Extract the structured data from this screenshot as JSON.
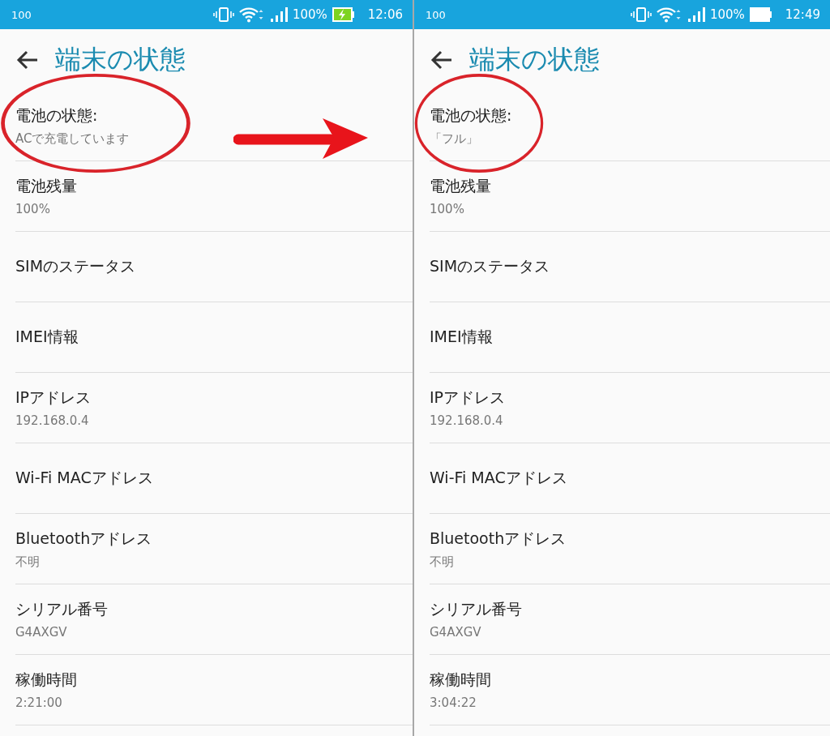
{
  "panels": [
    {
      "status_bar": {
        "left_text": "100",
        "battery_text": "100%",
        "charging": true,
        "time": "12:06"
      },
      "title": "端末の状態",
      "items": [
        {
          "title": "電池の状態:",
          "summary": "ACで充電しています",
          "circled": true
        },
        {
          "title": "電池残量",
          "summary": "100%",
          "circled": false
        },
        {
          "title": "SIMのステータス",
          "circled": false
        },
        {
          "title": "IMEI情報",
          "circled": false
        },
        {
          "title": "IPアドレス",
          "summary": "192.168.0.4",
          "circled": false
        },
        {
          "title": "Wi-Fi MACアドレス",
          "circled": false
        },
        {
          "title": "Bluetoothアドレス",
          "summary": "不明",
          "circled": false
        },
        {
          "title": "シリアル番号",
          "summary": "G4AXGV",
          "circled": false
        },
        {
          "title": "稼働時間",
          "summary": "2:21:00",
          "circled": false
        }
      ]
    },
    {
      "status_bar": {
        "left_text": "100",
        "battery_text": "100%",
        "charging": false,
        "time": "12:49"
      },
      "title": "端末の状態",
      "items": [
        {
          "title": "電池の状態:",
          "summary": "「フル」",
          "circled": true
        },
        {
          "title": "電池残量",
          "summary": "100%",
          "circled": false
        },
        {
          "title": "SIMのステータス",
          "circled": false
        },
        {
          "title": "IMEI情報",
          "circled": false
        },
        {
          "title": "IPアドレス",
          "summary": "192.168.0.4",
          "circled": false
        },
        {
          "title": "Wi-Fi MACアドレス",
          "circled": false
        },
        {
          "title": "Bluetoothアドレス",
          "summary": "不明",
          "circled": false
        },
        {
          "title": "シリアル番号",
          "summary": "G4AXGV",
          "circled": false
        },
        {
          "title": "稼働時間",
          "summary": "3:04:22",
          "circled": false
        }
      ]
    }
  ]
}
